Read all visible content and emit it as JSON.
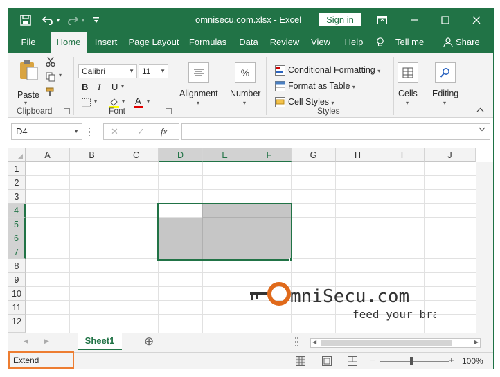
{
  "window": {
    "title": "omnisecu.com.xlsx  -  Excel",
    "sign_in_label": "Sign in"
  },
  "tabs": [
    "File",
    "Home",
    "Insert",
    "Page Layout",
    "Formulas",
    "Data",
    "Review",
    "View",
    "Help",
    "Tell me",
    "Share"
  ],
  "ribbon": {
    "clipboard": {
      "paste_label": "Paste",
      "group_label": "Clipboard"
    },
    "font": {
      "font_name": "Calibri",
      "font_size": "11",
      "bold": "B",
      "italic": "I",
      "underline": "U",
      "font_color_glyph": "A",
      "group_label": "Font"
    },
    "alignment": {
      "label": "Alignment"
    },
    "number": {
      "label": "Number",
      "glyph": "%"
    },
    "styles": {
      "conditional_formatting": "Conditional Formatting",
      "format_as_table": "Format as Table",
      "cell_styles": "Cell Styles",
      "group_label": "Styles"
    },
    "cells": {
      "label": "Cells"
    },
    "editing": {
      "label": "Editing"
    }
  },
  "formula_bar": {
    "name_box": "D4",
    "cancel_glyph": "✕",
    "enter_glyph": "✓",
    "fx_glyph": "fx",
    "content": ""
  },
  "grid": {
    "columns": [
      "A",
      "B",
      "C",
      "D",
      "E",
      "F",
      "G",
      "H",
      "I",
      "J"
    ],
    "rows": [
      "1",
      "2",
      "3",
      "4",
      "5",
      "6",
      "7",
      "8",
      "9",
      "10",
      "11",
      "12"
    ],
    "selected_range": "D4:F7",
    "active_cell": "D4"
  },
  "sheets": {
    "active": "Sheet1",
    "add_glyph": "⊕"
  },
  "status": {
    "mode": "Extend Selection",
    "zoom": "100%"
  },
  "logo": {
    "brand": "mniSecu.com",
    "tagline": "feed your brain"
  },
  "colors": {
    "excel_green": "#217346",
    "highlight_orange": "#ed7d31",
    "selection_fill": "#c6c6c6",
    "logo_orange": "#e06a1b"
  }
}
